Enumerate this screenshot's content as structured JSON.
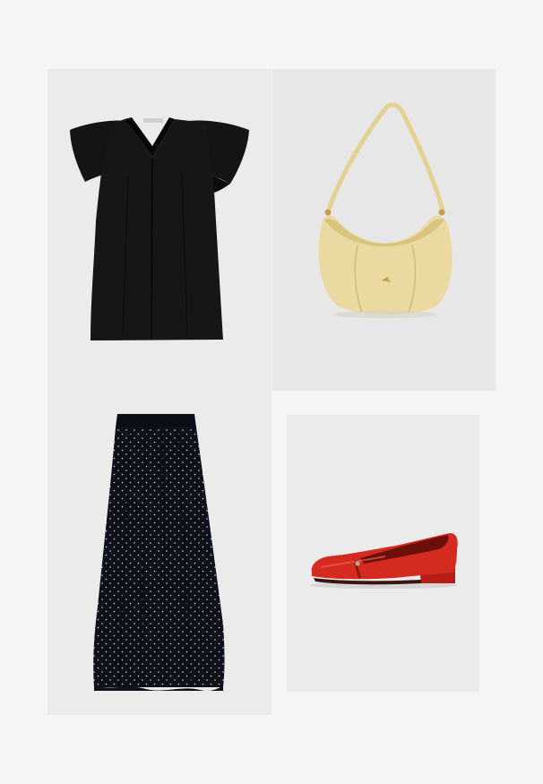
{
  "board": {
    "items": [
      {
        "name": "black-blouse",
        "colour": "#141414"
      },
      {
        "name": "yellow-shoulder-bag",
        "colour": "#ead9a0"
      },
      {
        "name": "black-polka-dot-skirt",
        "colour": "#0f111a"
      },
      {
        "name": "red-ballerina-flat",
        "colour": "#d52a20"
      }
    ]
  }
}
